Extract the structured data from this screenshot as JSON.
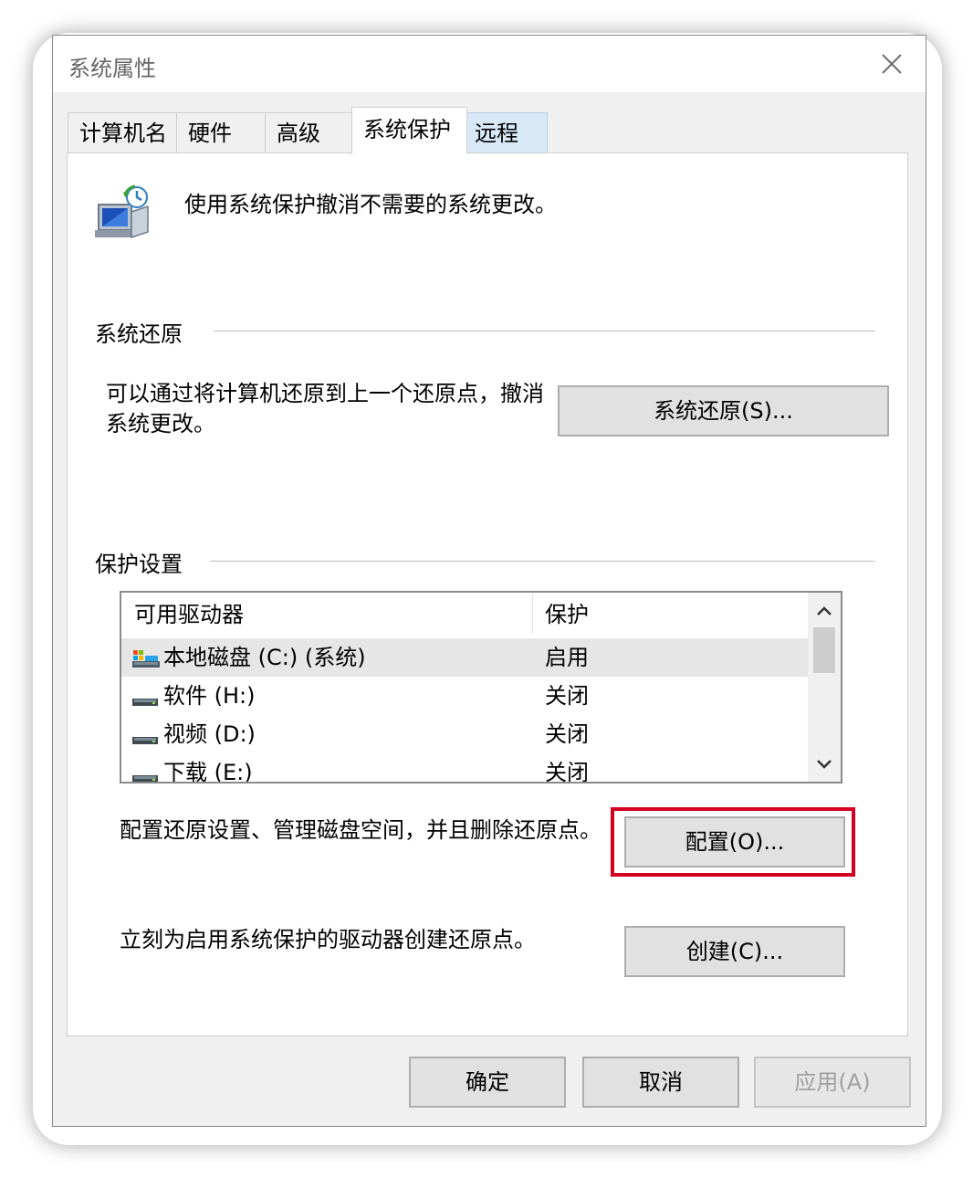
{
  "window": {
    "title": "系统属性"
  },
  "tabs": [
    {
      "label": "计算机名"
    },
    {
      "label": "硬件"
    },
    {
      "label": "高级"
    },
    {
      "label": "系统保护"
    },
    {
      "label": "远程"
    }
  ],
  "active_tab": "系统保护",
  "intro_text": "使用系统保护撤消不需要的系统更改。",
  "restore_group": {
    "label": "系统还原",
    "desc_line1": "可以通过将计算机还原到上一个还原点，撤消",
    "desc_line2": "系统更改。",
    "button": "系统还原(S)..."
  },
  "protection_group": {
    "label": "保护设置",
    "columns": [
      "可用驱动器",
      "保护"
    ],
    "drives": [
      {
        "name": "本地磁盘 (C:) (系统)",
        "protection": "启用",
        "icon": "system-drive-icon",
        "selected": true
      },
      {
        "name": "软件 (H:)",
        "protection": "关闭",
        "icon": "drive-icon"
      },
      {
        "name": "视频 (D:)",
        "protection": "关闭",
        "icon": "drive-icon"
      },
      {
        "name": "下载 (E:)",
        "protection": "关闭",
        "icon": "drive-icon"
      }
    ]
  },
  "configure": {
    "desc": "配置还原设置、管理磁盘空间，并且删除还原点。",
    "button": "配置(O)..."
  },
  "create": {
    "desc": "立刻为启用系统保护的驱动器创建还原点。",
    "button": "创建(C)..."
  },
  "footer": {
    "ok": "确定",
    "cancel": "取消",
    "apply": "应用(A)"
  },
  "colors": {
    "highlight": "#d4001f",
    "button_face": "#e1e1e1",
    "tab_hover": "#d9e8f7"
  }
}
